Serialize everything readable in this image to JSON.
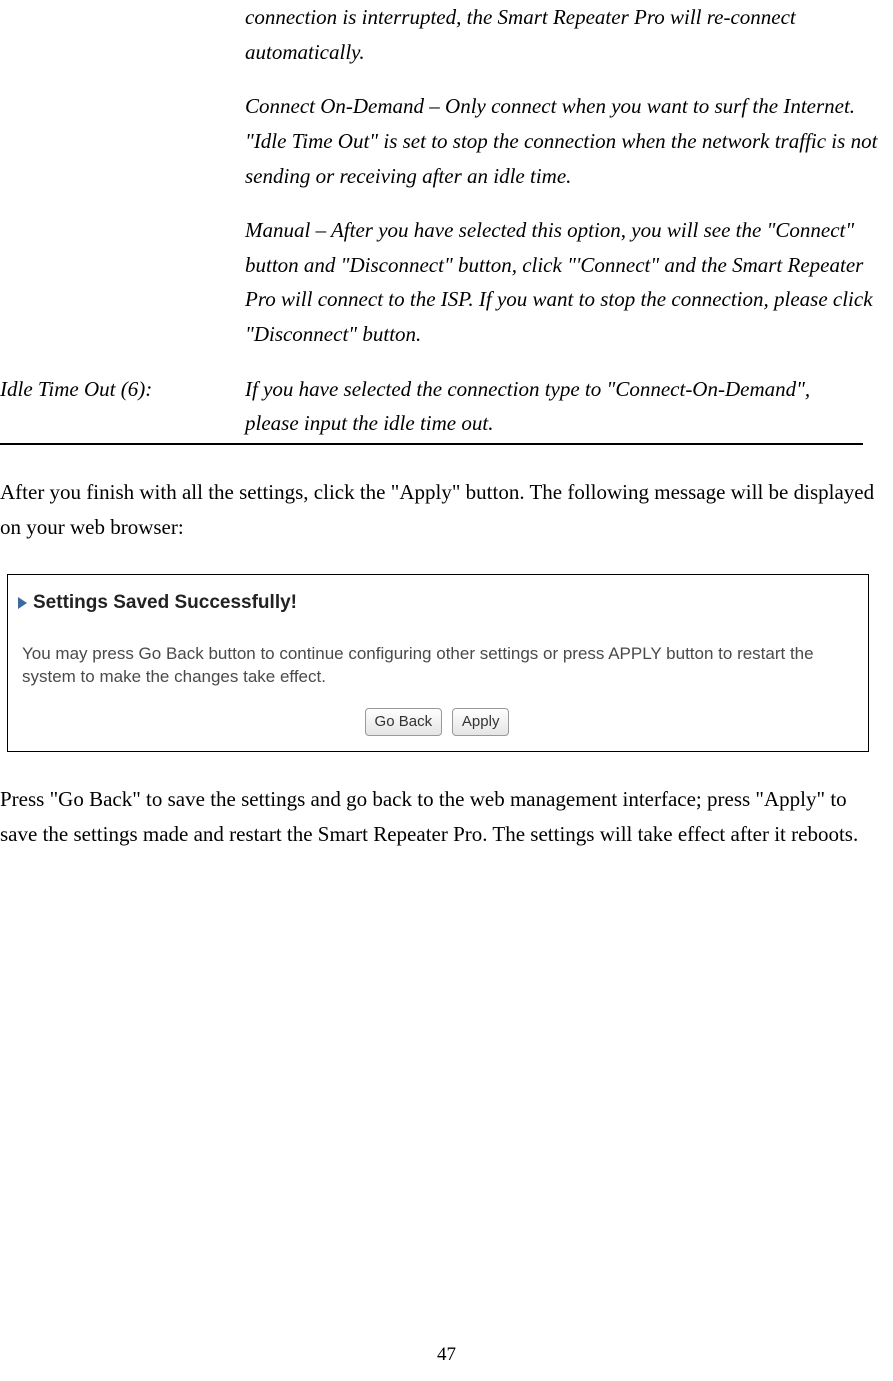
{
  "italic": {
    "p1": "connection is interrupted, the Smart Repeater Pro will re-connect automatically.",
    "p2": "Connect On-Demand – Only connect when you want to surf the Internet. \"Idle Time Out\" is set to stop the connection when the network traffic is not sending or receiving after an idle time.",
    "p3": "Manual – After you have selected this option, you will see the \"Connect\" button and \"Disconnect\" button, click \"'Connect\" and the Smart Repeater Pro will connect to the ISP. If you want to stop the connection, please click \"Disconnect\" button."
  },
  "def": {
    "label": "Idle Time Out (6):",
    "content": "If you have selected the connection type to \"Connect-On-Demand\", please input the idle time out."
  },
  "body1": "After you finish with all the settings, click the \"Apply\" button.    The following message will be displayed on your web browser:",
  "dialog": {
    "title": "Settings Saved Successfully!",
    "body": "You may press Go Back button to continue configuring other settings or press APPLY button to restart the system to make the changes take effect.",
    "goback": "Go Back",
    "apply": "Apply"
  },
  "body2": "Press \"Go Back\" to save the settings and go back to the web management interface; press \"Apply\" to save the settings made and restart the Smart Repeater Pro.    The settings will take effect after it reboots.",
  "page_number": "47"
}
